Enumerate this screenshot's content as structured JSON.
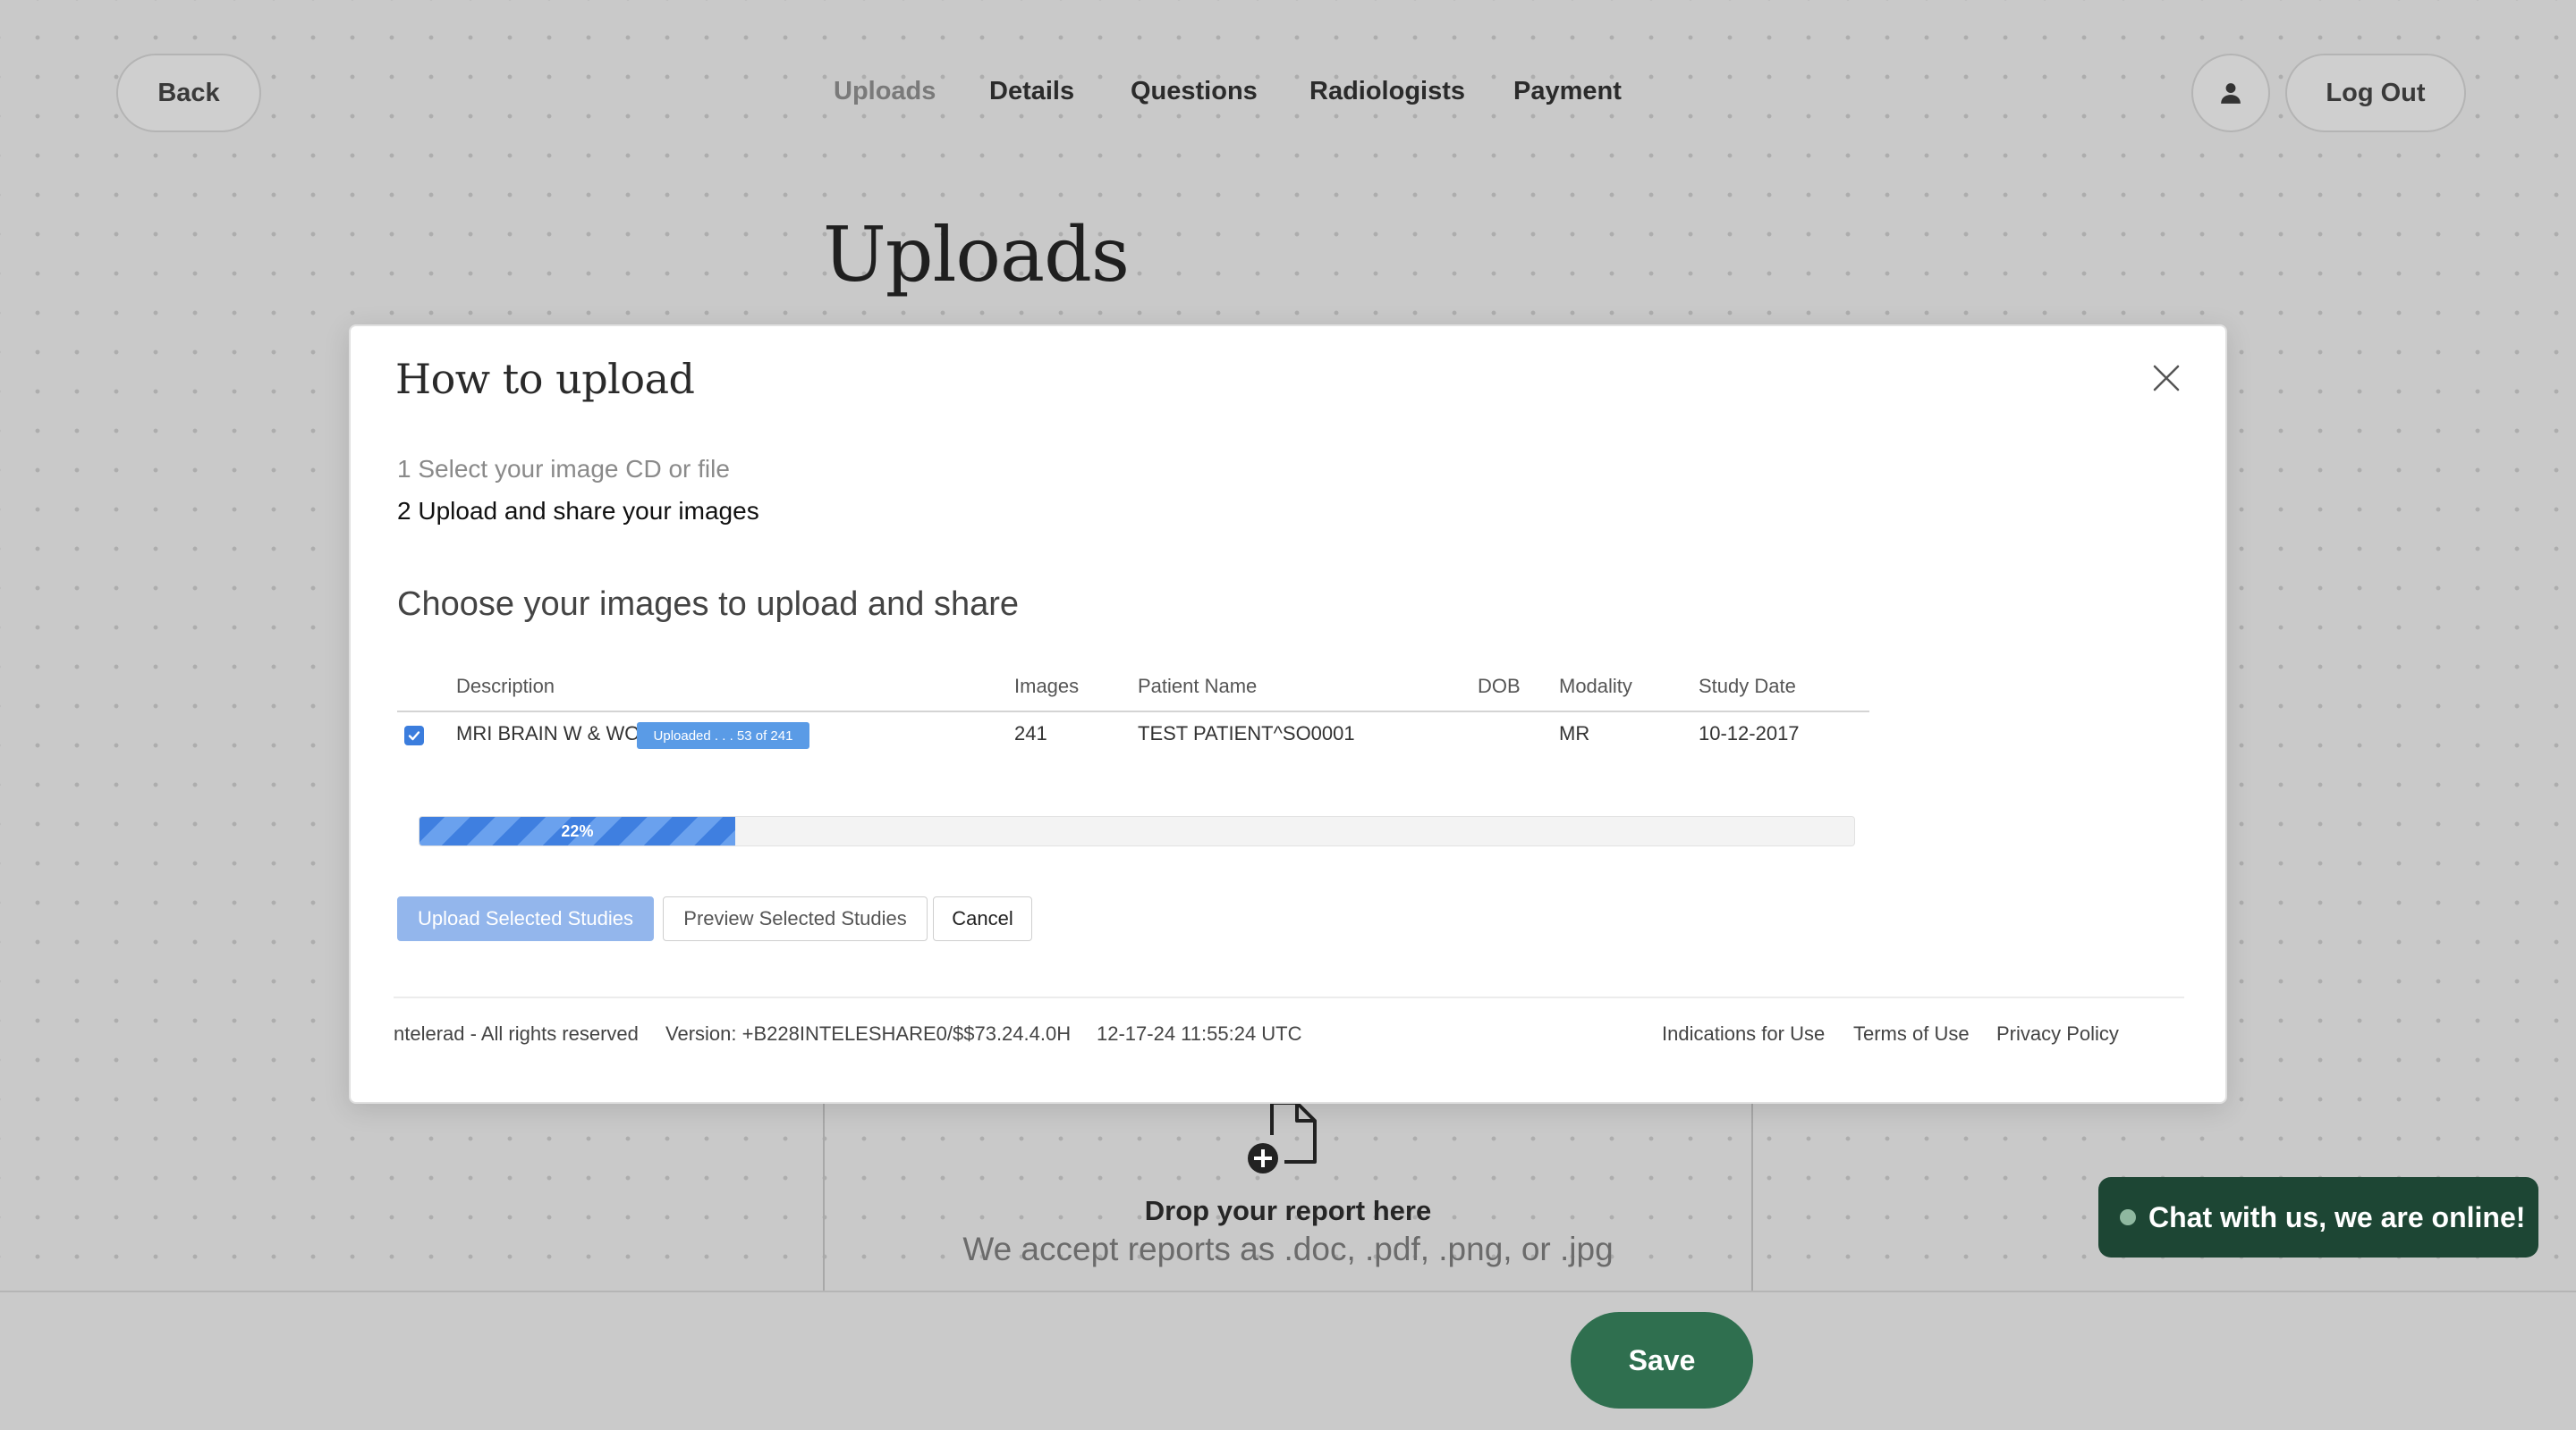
{
  "nav": {
    "back_label": "Back",
    "tabs": [
      {
        "label": "Uploads",
        "active": true
      },
      {
        "label": "Details",
        "active": false
      },
      {
        "label": "Questions",
        "active": false
      },
      {
        "label": "Radiologists",
        "active": false
      },
      {
        "label": "Payment",
        "active": false
      }
    ],
    "avatar_icon": "user-icon",
    "logout_label": "Log Out"
  },
  "page": {
    "title": "Uploads",
    "dropzone": {
      "icon": "file-add-icon",
      "title": "Drop your report here",
      "subtitle": "We accept reports as .doc, .pdf, .png, or .jpg"
    },
    "save_label": "Save",
    "chat_label": "Chat with us, we are online!"
  },
  "modal": {
    "title": "How to upload",
    "close_icon": "close-icon",
    "steps": [
      "1 Select your image CD or file",
      "2 Upload and share your images"
    ],
    "section_title": "Choose your images to upload and share",
    "table": {
      "headers": [
        "Description",
        "Images",
        "Patient Name",
        "DOB",
        "Modality",
        "Study Date"
      ],
      "rows": [
        {
          "checked": true,
          "description": "MRI BRAIN W & WO",
          "status_badge": "Uploaded . . . 53 of 241",
          "images": "241",
          "patient_name": "TEST PATIENT^SO0001",
          "dob": "",
          "modality": "MR",
          "study_date": "10-12-2017"
        }
      ]
    },
    "progress": {
      "percent": 22,
      "label": "22%"
    },
    "buttons": {
      "upload": "Upload Selected Studies",
      "preview": "Preview Selected Studies",
      "cancel": "Cancel"
    },
    "footer": {
      "copyright": "ntelerad - All rights reserved",
      "version": "Version: +B228INTELESHARE0/$$73.24.4.0H",
      "timestamp": "12-17-24 11:55:24 UTC",
      "links": [
        "Indications for Use",
        "Terms of Use",
        "Privacy Policy"
      ]
    }
  },
  "colors": {
    "save_green": "#2f6f4f",
    "chat_green": "#1d4634",
    "progress_blue": "#3f7fe0",
    "upload_button_blue": "#93b6ec",
    "badge_blue": "#5a9be6"
  }
}
